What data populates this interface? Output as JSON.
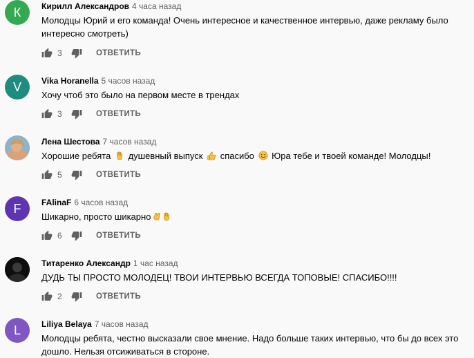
{
  "icons": {
    "like": "thumb-up-icon",
    "dislike": "thumb-down-icon"
  },
  "colors": {
    "avatar_k": "#34a853",
    "avatar_v": "#1e8c7e",
    "avatar_f": "#5e35b1",
    "avatar_l": "#7e57c2"
  },
  "reply_label": "ОТВЕТИТЬ",
  "comments": [
    {
      "initial": "К",
      "author": "Кирилл Александров",
      "time": "4 часа назад",
      "text": "Молодцы Юрий и его команда! Очень интересное и качественное интервью, даже рекламу было интересно смотреть)",
      "likes": "3"
    },
    {
      "initial": "V",
      "author": "Vika Horanella",
      "time": "5 часов назад",
      "text": "Хочу чтоб это было на первом месте в трендах",
      "likes": "3"
    },
    {
      "initial": "",
      "author": "Лена Шестова",
      "time": "7 часов назад",
      "text_parts": [
        "Хорошие ребята",
        "душевный выпуск",
        "спасибо",
        "Юра тебе и твоей команде! Молодцы!"
      ],
      "likes": "5"
    },
    {
      "initial": "F",
      "author": "FAlinaF",
      "time": "6 часов назад",
      "text": "Шикарно, просто шикарно",
      "likes": "6"
    },
    {
      "initial": "",
      "author": "Титаренко Александр",
      "time": "1 час назад",
      "text": "ДУДЬ ТЫ ПРОСТО МОЛОДЕЦ! ТВОИ ИНТЕРВЬЮ ВСЕГДА ТОПОВЫЕ! СПАСИБО!!!!",
      "likes": "2"
    },
    {
      "initial": "L",
      "author": "Liliya Belaya",
      "time": "7 часов назад",
      "text": "Молодцы ребята, честно высказали свое мнение. Надо больше таких интервью, что бы до всех это дошло. Нельзя отсиживаться в стороне.",
      "likes": ""
    }
  ]
}
